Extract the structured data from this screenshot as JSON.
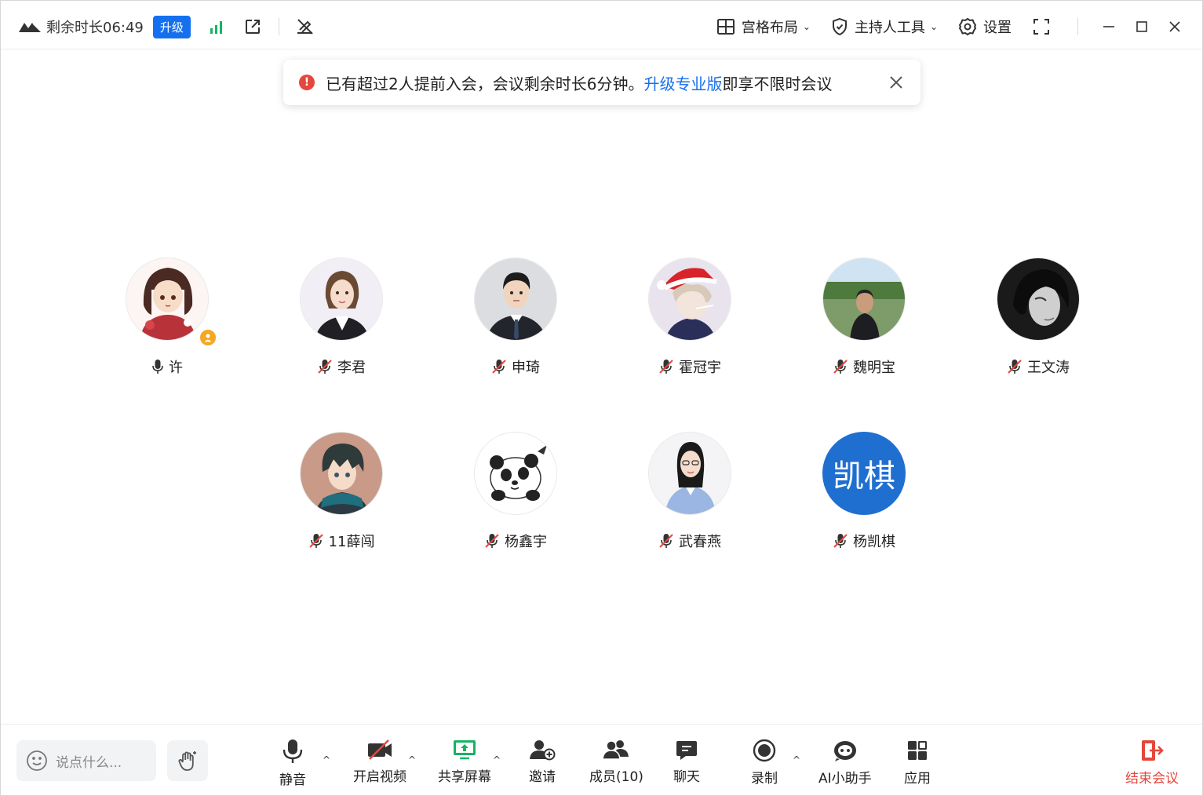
{
  "titlebar": {
    "remaining": "剩余时长06:49",
    "upgrade": "升级",
    "layout": "宫格布局",
    "host_tools": "主持人工具",
    "settings": "设置",
    "chevron": "⌄"
  },
  "notice": {
    "text_before": "已有超过2人提前入会，会议剩余时长6分钟。",
    "link": "升级专业版",
    "text_after": "即享不限时会议"
  },
  "participants": [
    {
      "name": "许",
      "avatar": "anime-girl-avatar",
      "muted": false,
      "host": true
    },
    {
      "name": "李君",
      "avatar": "woman-suit-avatar",
      "muted": true
    },
    {
      "name": "申琦",
      "avatar": "man-suit-avatar",
      "muted": true
    },
    {
      "name": "霍冠宇",
      "avatar": "santa-hat-avatar",
      "muted": true
    },
    {
      "name": "魏明宝",
      "avatar": "lake-man-avatar",
      "muted": true
    },
    {
      "name": "王文涛",
      "avatar": "dark-hair-avatar",
      "muted": true
    },
    {
      "name": "11薛闯",
      "avatar": "anime-boy-avatar",
      "muted": true
    },
    {
      "name": "杨鑫宇",
      "avatar": "panda-avatar",
      "muted": true
    },
    {
      "name": "武春燕",
      "avatar": "woman-shirt-avatar",
      "muted": true
    },
    {
      "name": "杨凯棋",
      "avatar_text": "凯棋",
      "muted": true
    }
  ],
  "bottombar": {
    "say_placeholder": "说点什么...",
    "mute": "静音",
    "video": "开启视频",
    "share": "共享屏幕",
    "invite": "邀请",
    "members": "成员(10)",
    "chat": "聊天",
    "record": "录制",
    "ai": "AI小助手",
    "apps": "应用",
    "end": "结束会议",
    "caret": "^"
  },
  "colors": {
    "accent": "#1570ef",
    "danger": "#e5473c",
    "signal": "#16b364",
    "share": "#16b364",
    "host_badge": "#f5a623"
  }
}
